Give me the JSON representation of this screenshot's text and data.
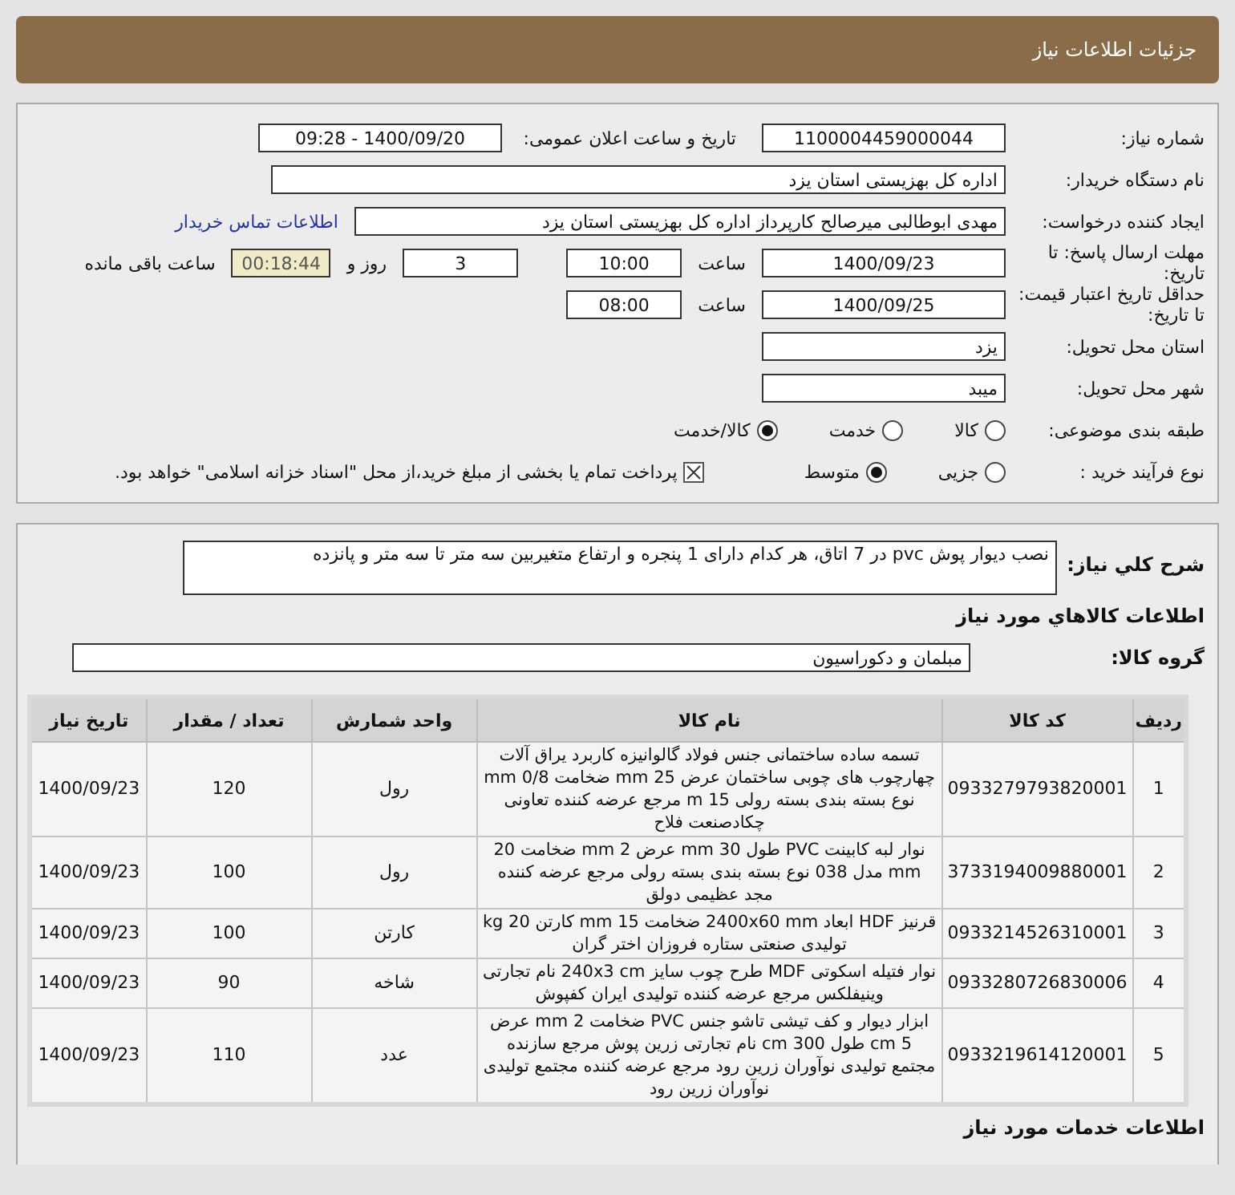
{
  "header": {
    "title": "جزئیات اطلاعات نیاز"
  },
  "form": {
    "need_number": {
      "label": "شماره نیاز:",
      "value": "1100004459000044"
    },
    "announce": {
      "label": "تاریخ و ساعت اعلان عمومی:",
      "value": "1400/09/20 - 09:28"
    },
    "buyer": {
      "label": "نام دستگاه خریدار:",
      "value": "اداره کل بهزیستی استان یزد"
    },
    "requester": {
      "label": "ایجاد کننده درخواست:",
      "value": "مهدی ابوطالبی میرصالح کارپرداز اداره کل بهزیستی استان یزد"
    },
    "contact_link": "اطلاعات تماس خریدار",
    "deadline": {
      "label": "مهلت ارسال پاسخ: تا تاریخ:",
      "date": "1400/09/23",
      "time_label": "ساعت",
      "time": "10:00",
      "days": "3",
      "days_label": "روز و",
      "remaining": "00:18:44",
      "remaining_label": "ساعت باقی مانده"
    },
    "validity": {
      "label": "حداقل تاریخ اعتبار قیمت: تا تاریخ:",
      "date": "1400/09/25",
      "time_label": "ساعت",
      "time": "08:00"
    },
    "province": {
      "label": "استان محل تحویل:",
      "value": "یزد"
    },
    "city": {
      "label": "شهر محل تحویل:",
      "value": "میبد"
    },
    "category": {
      "label": "طبقه بندی موضوعی:",
      "options": [
        {
          "label": "کالا",
          "selected": false
        },
        {
          "label": "خدمت",
          "selected": false
        },
        {
          "label": "کالا/خدمت",
          "selected": true
        }
      ]
    },
    "process": {
      "label": "نوع فرآیند خرید :",
      "options": [
        {
          "label": "جزیی",
          "selected": false
        },
        {
          "label": "متوسط",
          "selected": true
        }
      ],
      "payment": {
        "label": "پرداخت تمام یا بخشی از مبلغ خرید،از محل \"اسناد خزانه اسلامی\" خواهد بود.",
        "checked": true
      }
    }
  },
  "description": {
    "label": "شرح کلي نياز:",
    "value": "نصب دیوار پوش pvc در 7 اتاق، هر کدام دارای 1 پنجره و ارتفاع متغیربین سه متر تا سه متر و پانزده"
  },
  "goods_heading": "اطلاعات کالاهاي مورد نياز",
  "group": {
    "label": "گروه کالا:",
    "value": "مبلمان و دکوراسیون"
  },
  "table": {
    "columns": [
      "ردیف",
      "کد کالا",
      "نام کالا",
      "واحد شمارش",
      "تعداد / مقدار",
      "تاریخ نیاز"
    ],
    "rows": [
      {
        "row_number": "1",
        "code": "0933279793820001",
        "name": "تسمه ساده ساختمانی جنس فولاد گالوانیزه کاربرد یراق آلات چهارچوب های چوبی ساختمان عرض 25 mm ضخامت 0/8 mm نوع بسته بندی بسته رولی 15 m مرجع عرضه کننده تعاونی چکادصنعت فلاح",
        "unit": "رول",
        "quantity": "120",
        "date": "1400/09/23"
      },
      {
        "row_number": "2",
        "code": "3733194009880001",
        "name": "نوار لبه کابینت PVC طول 30 mm عرض 2 mm ضخامت 20 mm مدل 038 نوع بسته بندی بسته رولی مرجع عرضه کننده مجد عظیمی دولق",
        "unit": "رول",
        "quantity": "100",
        "date": "1400/09/23"
      },
      {
        "row_number": "3",
        "code": "0933214526310001",
        "name": "قرنیز HDF ابعاد 2400x60 mm ضخامت 15 mm کارتن 20 kg تولیدی صنعتی ستاره فروزان اختر گران",
        "unit": "کارتن",
        "quantity": "100",
        "date": "1400/09/23"
      },
      {
        "row_number": "4",
        "code": "0933280726830006",
        "name": "نوار فتیله اسکوتی MDF طرح چوب سایز 240x3 cm نام تجارتی وینیفلکس مرجع عرضه کننده تولیدی ایران کفپوش",
        "unit": "شاخه",
        "quantity": "90",
        "date": "1400/09/23"
      },
      {
        "row_number": "5",
        "code": "0933219614120001",
        "name": "ابزار دیوار و کف تیشی تاشو جنس PVC ضخامت 2 mm عرض 5 cm طول 300 cm نام تجارتی زرین پوش مرجع سازنده مجتمع تولیدی نوآوران زرین رود مرجع عرضه کننده مجتمع تولیدی نوآوران زرین رود",
        "unit": "عدد",
        "quantity": "110",
        "date": "1400/09/23"
      }
    ]
  },
  "services_heading": "اطلاعات خدمات مورد نياز"
}
